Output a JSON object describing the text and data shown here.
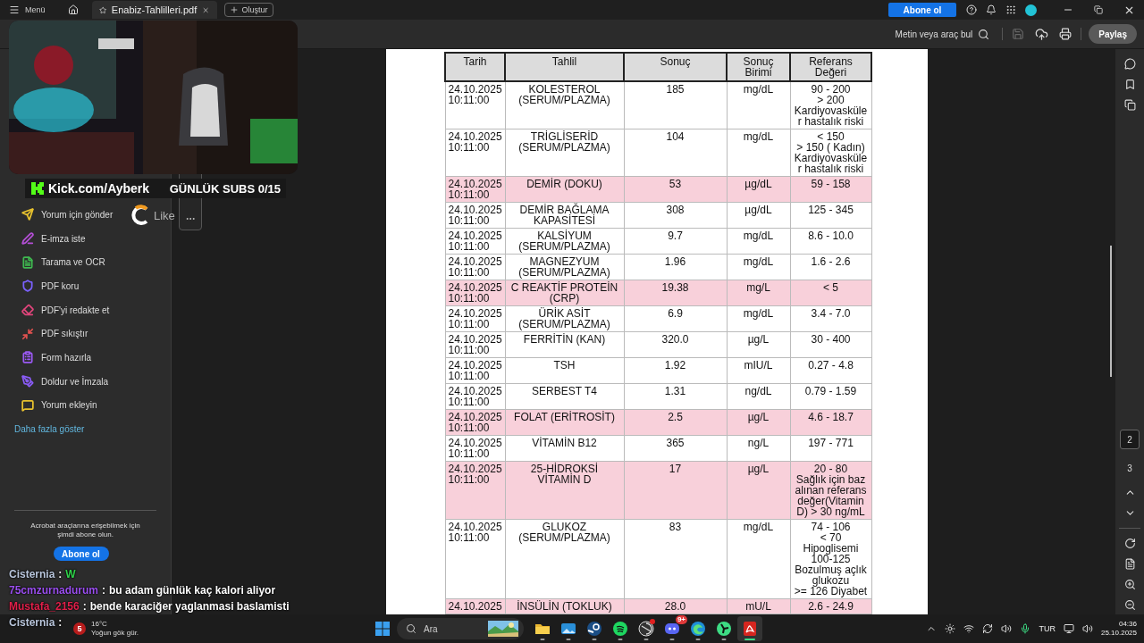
{
  "title_bar": {
    "menu_label": "Menü",
    "tab_title": "Enabiz-Tahlilleri.pdf",
    "create_label": "Oluştur",
    "subscribe_label": "Abone ol"
  },
  "toolbar": {
    "search_placeholder": "Metin veya araç bul",
    "save_disabled": true,
    "share_label": "Paylaş"
  },
  "sidebar": {
    "items": [
      {
        "kind": "send",
        "label": "Yorum için gönder",
        "color": "#e8c22e"
      },
      {
        "kind": "sign",
        "label": "E-imza iste",
        "color": "#b44fd6"
      },
      {
        "kind": "scan",
        "label": "Tarama ve OCR",
        "color": "#3fb950"
      },
      {
        "kind": "protect",
        "label": "PDF koru",
        "color": "#7b61ff"
      },
      {
        "kind": "redact",
        "label": "PDF'yi redakte et",
        "color": "#e0457b"
      },
      {
        "kind": "compress",
        "label": "PDF sıkıştır",
        "color": "#e0514f"
      },
      {
        "kind": "form",
        "label": "Form hazırla",
        "color": "#9b59f5"
      },
      {
        "kind": "fill",
        "label": "Doldur ve İmzala",
        "color": "#8a5cf6"
      },
      {
        "kind": "comment",
        "label": "Yorum ekleyin",
        "color": "#e8c22e"
      }
    ],
    "more_label": "Daha fazla göster",
    "promo": "Acrobat araçlarına erişebilmek için\nşimdi abone olun.",
    "promo_button": "Abone ol"
  },
  "document": {
    "columns": [
      "Tarih",
      "Tahlil",
      "Sonuç",
      "Sonuç\nBirimi",
      "Referans\nDeğeri"
    ],
    "rows": [
      {
        "date": "24.10.2025\n10:11:00",
        "test": "KOLESTEROL\n(SERUM/PLAZMA)",
        "result": "185",
        "unit": "mg/dL",
        "reference": "90 - 200\n> 200\nKardiyovasküle\nr hastalık riski",
        "flagged": false
      },
      {
        "date": "24.10.2025\n10:11:00",
        "test": "TRİGLİSERİD\n(SERUM/PLAZMA)",
        "result": "104",
        "unit": "mg/dL",
        "reference": "< 150\n> 150  ( Kadın)\nKardiyovasküle\nr hastalık riski",
        "flagged": false
      },
      {
        "date": "24.10.2025\n10:11:00",
        "test": "DEMİR (DOKU)",
        "result": "53",
        "unit": "µg/dL",
        "reference": "59 - 158",
        "flagged": true
      },
      {
        "date": "24.10.2025\n10:11:00",
        "test": "DEMİR BAĞLAMA\nKAPASİTESİ",
        "result": "308",
        "unit": "µg/dL",
        "reference": "125 - 345",
        "flagged": false
      },
      {
        "date": "24.10.2025\n10:11:00",
        "test": "KALSİYUM\n(SERUM/PLAZMA)",
        "result": "9.7",
        "unit": "mg/dL",
        "reference": "8.6 - 10.0",
        "flagged": false
      },
      {
        "date": "24.10.2025\n10:11:00",
        "test": "MAGNEZYUM\n(SERUM/PLAZMA)",
        "result": "1.96",
        "unit": "mg/dL",
        "reference": "1.6 - 2.6",
        "flagged": false
      },
      {
        "date": "24.10.2025\n10:11:00",
        "test": "C REAKTİF PROTEİN\n(CRP)",
        "result": "19.38",
        "unit": "mg/L",
        "reference": "< 5",
        "flagged": true
      },
      {
        "date": "24.10.2025\n10:11:00",
        "test": "ÜRİK ASİT\n(SERUM/PLAZMA)",
        "result": "6.9",
        "unit": "mg/dL",
        "reference": "3.4 - 7.0",
        "flagged": false
      },
      {
        "date": "24.10.2025\n10:11:00",
        "test": "FERRİTİN (KAN)",
        "result": "320.0",
        "unit": "µg/L",
        "reference": "30 - 400",
        "flagged": false
      },
      {
        "date": "24.10.2025\n10:11:00",
        "test": "TSH",
        "result": "1.92",
        "unit": "mIU/L",
        "reference": "0.27 - 4.8",
        "flagged": false
      },
      {
        "date": "24.10.2025\n10:11:00",
        "test": "SERBEST T4",
        "result": "1.31",
        "unit": "ng/dL",
        "reference": "0.79 - 1.59",
        "flagged": false
      },
      {
        "date": "24.10.2025\n10:11:00",
        "test": "FOLAT (ERİTROSİT)",
        "result": "2.5",
        "unit": "µg/L",
        "reference": "4.6 - 18.7",
        "flagged": true
      },
      {
        "date": "24.10.2025\n10:11:00",
        "test": "VİTAMİN B12",
        "result": "365",
        "unit": "ng/L",
        "reference": "197 - 771",
        "flagged": false
      },
      {
        "date": "24.10.2025\n10:11:00",
        "test": "25-HİDROKSİ\nVİTAMİN D",
        "result": "17",
        "unit": "µg/L",
        "reference": "20 - 80\nSağlık için baz\nalınan referans\ndeğer(Vitamin\nD) > 30 ng/mL",
        "flagged": true
      },
      {
        "date": "24.10.2025\n10:11:00",
        "test": "GLUKOZ\n(SERUM/PLAZMA)",
        "result": "83",
        "unit": "mg/dL",
        "reference": "74 - 106\n< 70\nHipoglisemi\n100-125\nBozulmuş açlık\nglukozu\n>= 126 Diyabet",
        "flagged": false
      },
      {
        "date": "24.10.2025",
        "test": "İNSÜLİN (TOKLUK)",
        "result": "28.0",
        "unit": "mU/L",
        "reference": "2.6 - 24.9",
        "flagged": true
      }
    ]
  },
  "page_nav": {
    "pages": [
      {
        "label": "2",
        "selected": true
      },
      {
        "label": "3",
        "selected": false
      }
    ]
  },
  "taskbar": {
    "weather": {
      "badge": "5",
      "temperature": "16°C",
      "condition": "Yoğun gök gür."
    },
    "search_placeholder": "Ara",
    "apps": [
      {
        "kind": "folder",
        "selected": false,
        "dot": false
      },
      {
        "kind": "photos",
        "selected": false,
        "dot": false
      },
      {
        "kind": "steam",
        "selected": false,
        "dot": false
      },
      {
        "kind": "music",
        "selected": false,
        "dot": false
      },
      {
        "kind": "aperture",
        "selected": false,
        "dot": true
      },
      {
        "kind": "discord",
        "selected": false,
        "dot": false,
        "badge": "9+"
      },
      {
        "kind": "browser",
        "selected": false,
        "dot": false
      },
      {
        "kind": "fan",
        "selected": false,
        "dot": false
      },
      {
        "kind": "pdf",
        "selected": true,
        "dot": false
      }
    ],
    "language": "TUR",
    "time": "04:36",
    "date": "25.10.2025"
  },
  "stream_overlay": {
    "channel": "Kick.com/Ayberk",
    "subs": "GÜNLÜK SUBS 0/15",
    "like": "Like",
    "chat": [
      {
        "user": "Cisternia",
        "color": "#b9c6dc",
        "separator": ":",
        "kind": "emote",
        "message": "W"
      },
      {
        "user": "75cmzurnadurum",
        "color": "#9b4ff0",
        "separator": ":",
        "kind": "text",
        "message": "bu adam günlük kaç kalori aliyor"
      },
      {
        "user": "Mustafa_2156",
        "color": "#e0204a",
        "separator": ":",
        "kind": "text",
        "message": "bende karaciğer yaglanmasi baslamisti"
      },
      {
        "user": "Cisternia",
        "color": "#b9c6dc",
        "separator": ":"
      }
    ]
  }
}
